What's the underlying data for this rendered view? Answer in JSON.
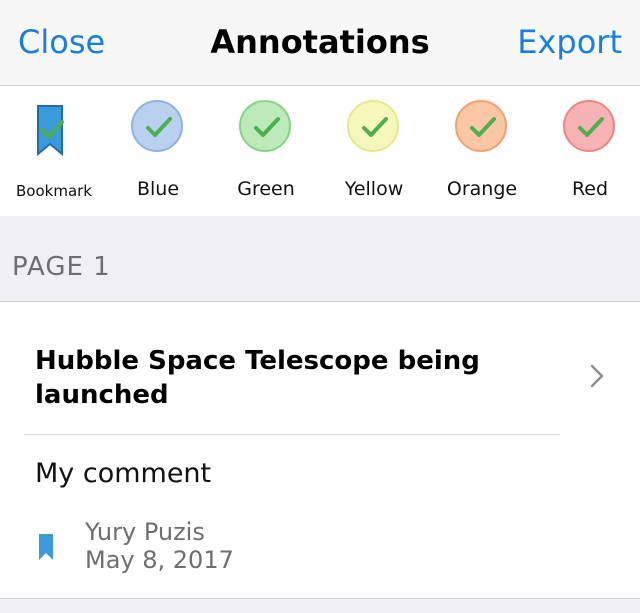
{
  "nav": {
    "close_label": "Close",
    "title": "Annotations",
    "export_label": "Export"
  },
  "filters": [
    {
      "label": "Bookmark",
      "icon": "bookmark-icon",
      "color": "#3b9ad9"
    },
    {
      "label": "Blue",
      "color": "#b9d0ee",
      "border": "#8fb2e0"
    },
    {
      "label": "Green",
      "color": "#bdeab9",
      "border": "#86d486"
    },
    {
      "label": "Yellow",
      "color": "#f6f7bc",
      "border": "#e6e98a"
    },
    {
      "label": "Orange",
      "color": "#fbc7a4",
      "border": "#f4a070"
    },
    {
      "label": "Red",
      "color": "#f7b3b3",
      "border": "#ee8585"
    }
  ],
  "section": {
    "title": "PAGE 1"
  },
  "annotation": {
    "title": "Hubble Space Telescope being launched",
    "comment": "My comment",
    "author": "Yury Puzis",
    "date": "May 8, 2017",
    "icon": "bookmark-icon"
  },
  "colors": {
    "accent": "#1a7ee0",
    "check": "#4caf50"
  }
}
